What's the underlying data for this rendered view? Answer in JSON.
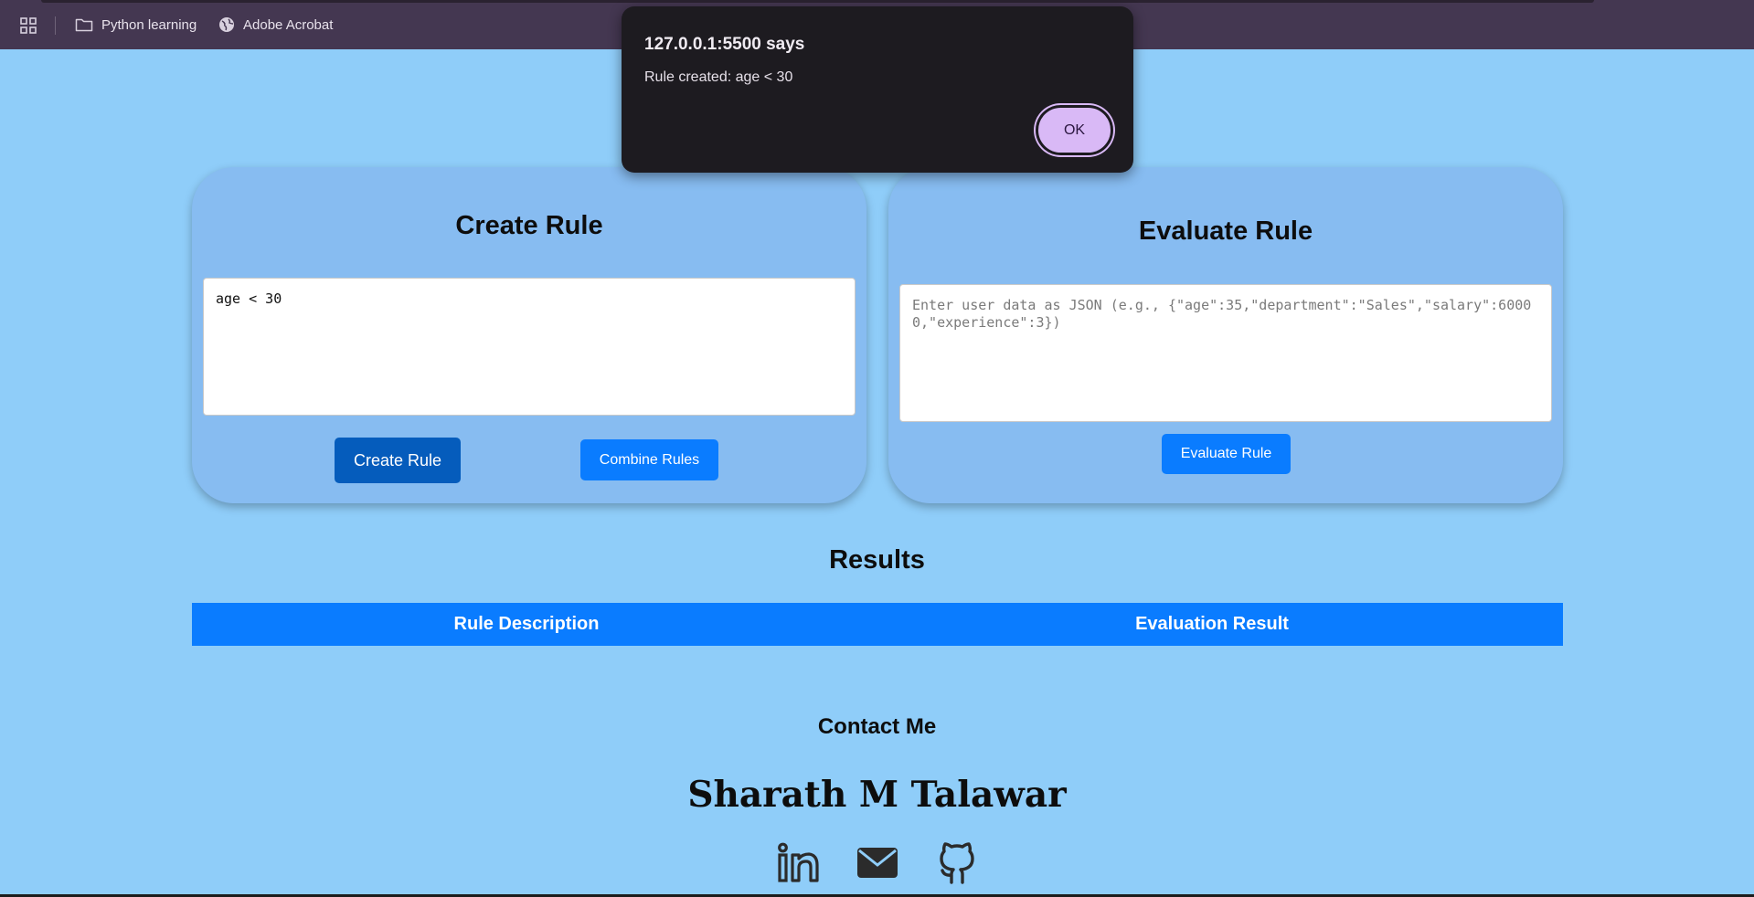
{
  "bookmarks": {
    "items": [
      {
        "label": "Python learning",
        "icon": "folder-icon"
      },
      {
        "label": "Adobe Acrobat",
        "icon": "globe-icon"
      }
    ]
  },
  "dialog": {
    "title": "127.0.0.1:5500 says",
    "message": "Rule created: age < 30",
    "ok_label": "OK"
  },
  "create_rule": {
    "title": "Create Rule",
    "input_value": "age < 30",
    "create_button": "Create Rule",
    "combine_button": "Combine Rules"
  },
  "evaluate_rule": {
    "title": "Evaluate Rule",
    "placeholder": "Enter user data as JSON (e.g., {\"age\":35,\"department\":\"Sales\",\"salary\":60000,\"experience\":3})",
    "evaluate_button": "Evaluate Rule"
  },
  "results": {
    "title": "Results",
    "columns": [
      "Rule Description",
      "Evaluation Result"
    ]
  },
  "footer": {
    "contact_title": "Contact Me",
    "name": "Sharath M Talawar",
    "socials": [
      "linkedin-icon",
      "mail-icon",
      "github-icon"
    ]
  },
  "colors": {
    "page_bg": "#8fcdf9",
    "card_bg": "#87bcf1",
    "primary_button": "#0a7cff",
    "active_button": "#055cbc",
    "dialog_bg": "#1d1b20",
    "dialog_ok": "#d9b9f6",
    "bookmarks_bg": "#443751"
  }
}
